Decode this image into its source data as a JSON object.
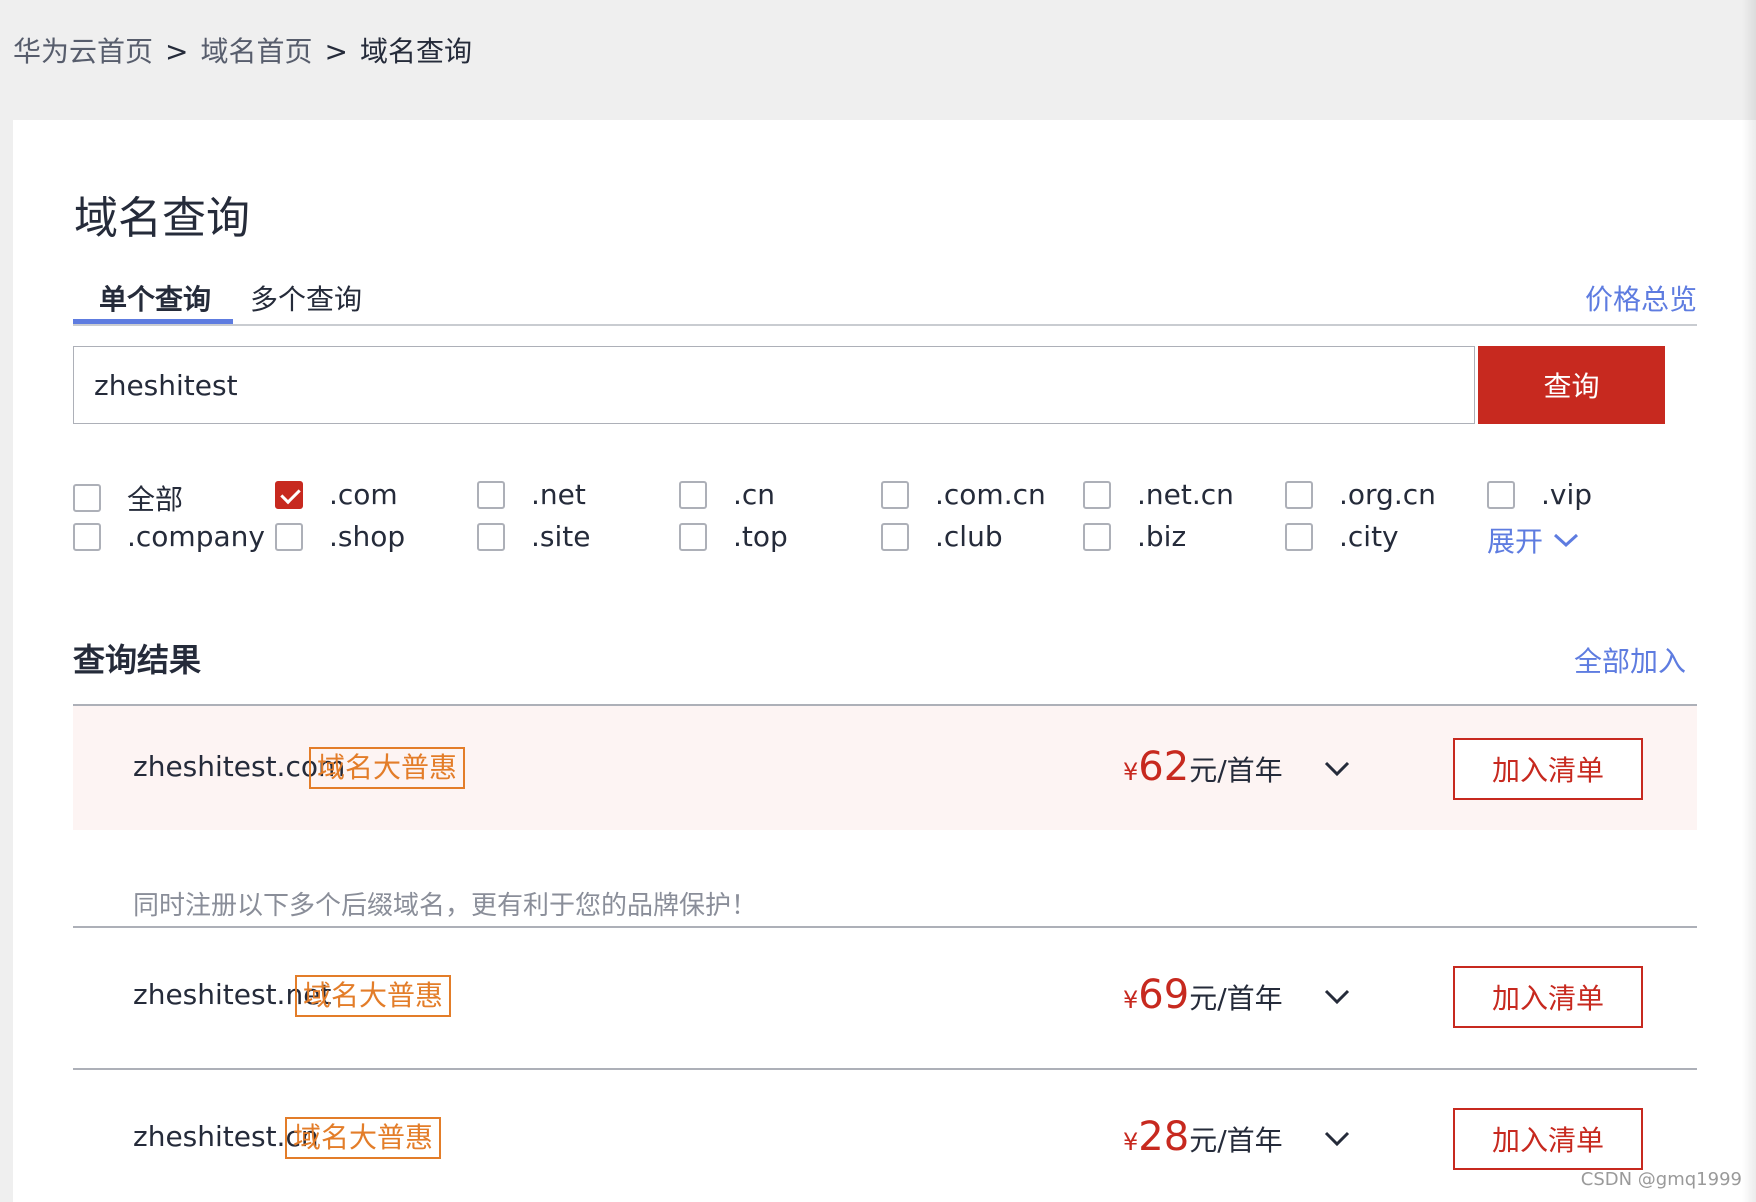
{
  "breadcrumb": {
    "items": [
      "华为云首页",
      "域名首页",
      "域名查询"
    ],
    "separator": ">"
  },
  "page": {
    "title": "域名查询"
  },
  "tabs": {
    "items": [
      "单个查询",
      "多个查询"
    ],
    "active_index": 0,
    "price_overview": "价格总览"
  },
  "search": {
    "value": "zheshitest",
    "button_label": "查询"
  },
  "tlds": {
    "items": [
      {
        "label": "全部",
        "checked": false
      },
      {
        "label": ".com",
        "checked": true
      },
      {
        "label": ".net",
        "checked": false
      },
      {
        "label": ".cn",
        "checked": false
      },
      {
        "label": ".com.cn",
        "checked": false
      },
      {
        "label": ".net.cn",
        "checked": false
      },
      {
        "label": ".org.cn",
        "checked": false
      },
      {
        "label": ".vip",
        "checked": false
      },
      {
        "label": ".company",
        "checked": false
      },
      {
        "label": ".shop",
        "checked": false
      },
      {
        "label": ".site",
        "checked": false
      },
      {
        "label": ".top",
        "checked": false
      },
      {
        "label": ".club",
        "checked": false
      },
      {
        "label": ".biz",
        "checked": false
      },
      {
        "label": ".city",
        "checked": false
      }
    ],
    "expand_label": "展开"
  },
  "results": {
    "title": "查询结果",
    "add_all": "全部加入",
    "hint": "同时注册以下多个后缀域名，更有利于您的品牌保护！",
    "items": [
      {
        "domain": "zheshitest.com",
        "promo": "域名大普惠",
        "currency": "¥",
        "price": "62",
        "unit": "元/首年",
        "button": "加入清单"
      },
      {
        "domain": "zheshitest.net",
        "promo": "域名大普惠",
        "currency": "¥",
        "price": "69",
        "unit": "元/首年",
        "button": "加入清单"
      },
      {
        "domain": "zheshitest.cn",
        "promo": "域名大普惠",
        "currency": "¥",
        "price": "28",
        "unit": "元/首年",
        "button": "加入清单"
      }
    ]
  },
  "watermark": "CSDN @gmq1999",
  "colors": {
    "accent_red": "#c7291f",
    "link_blue": "#5e7ce0",
    "promo_orange": "#e37d29",
    "highlight_row": "#fdf4f3"
  }
}
